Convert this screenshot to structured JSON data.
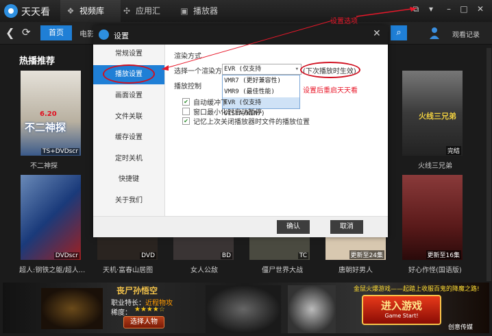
{
  "app": {
    "title": "天天看"
  },
  "top_tabs": [
    {
      "label": "视频库",
      "icon": "camera-icon"
    },
    {
      "label": "应用汇",
      "icon": "pinwheel-icon"
    },
    {
      "label": "播放器",
      "icon": "player-icon"
    }
  ],
  "nav": {
    "home": "首页",
    "movie_partial": "电影",
    "history": "观看记录"
  },
  "section": {
    "title": "热播推荐"
  },
  "posters": [
    {
      "title": "不二神探",
      "tag": "TS+DVDscr",
      "color": "#c9c3b7"
    },
    {
      "title": "",
      "tag": "",
      "color": "#5a4a3a"
    },
    {
      "title": "",
      "tag": "",
      "color": "#3a3a4a"
    },
    {
      "title": "",
      "tag": "",
      "color": "#4a3a2a"
    },
    {
      "title": "",
      "tag": "",
      "color": "#2a2a2a"
    },
    {
      "title": "火线三兄弟",
      "tag": "完结",
      "color": "#4a4a48"
    },
    {
      "title": "超人:钢铁之躯/超人...",
      "tag": "DVDscr",
      "color": "#2a4a7a"
    },
    {
      "title": "天机·富春山居图",
      "tag": "DVD",
      "color": "#2a2420"
    },
    {
      "title": "女人公敌",
      "tag": "BD",
      "color": "#3a3434"
    },
    {
      "title": "僵尸世界大战",
      "tag": "TC",
      "color": "#4a4a40"
    },
    {
      "title": "唐朝好男人",
      "tag": "更新至24集",
      "color": "#d8c8b0"
    },
    {
      "title": "好心作怪(国语版)",
      "tag": "更新至16集",
      "color": "#6a2a2a"
    }
  ],
  "poster_overlay": {
    "title_text": "不二神探",
    "date": "6.20",
    "san": "火线三兄弟"
  },
  "banner": {
    "hero": "丧尸孙悟空",
    "job_label": "职业特长：",
    "job_value": "近程物攻",
    "rarity_label": "稀度：",
    "stars": "★★★★☆",
    "choose": "选择人物",
    "ticker": "金鼠火爆游戏——起踏上收服百鬼的降魔之路!",
    "enter": "进入游戏",
    "enter_sub": "Game Start!",
    "credit": "创意传媒"
  },
  "dialog": {
    "title": "设置",
    "sidebar": [
      "常规设置",
      "播放设置",
      "画面设置",
      "文件关联",
      "缓存设置",
      "定时关机",
      "快捷键",
      "关于我们"
    ],
    "active_index": 1,
    "render_mode_heading": "渲染方式",
    "render_label": "选择一个渲染方式",
    "render_value": "EVR (仅支持VISTA/WIN7)",
    "render_options": [
      "VMR7 (更好兼容性)",
      "VMR9 (最佳性能)",
      "EVR (仅支持VISTA/WIN7)"
    ],
    "render_selected_index": 2,
    "effective_note": "(下次播放时生效)",
    "play_control_heading": "播放控制",
    "checkboxes": [
      {
        "label": "自动缓冲下",
        "checked": true
      },
      {
        "label": "窗口最小化时自动暂停",
        "checked": false
      },
      {
        "label": "记忆上次关闭播放器时文件的播放位置",
        "checked": true
      }
    ],
    "ok": "确认",
    "cancel": "取消"
  },
  "annotations": {
    "settings_option": "设置选项",
    "restart_note": "设置后重启天天看"
  },
  "colors": {
    "accent": "#1f7fd6",
    "annotation_red": "#e8182a"
  }
}
